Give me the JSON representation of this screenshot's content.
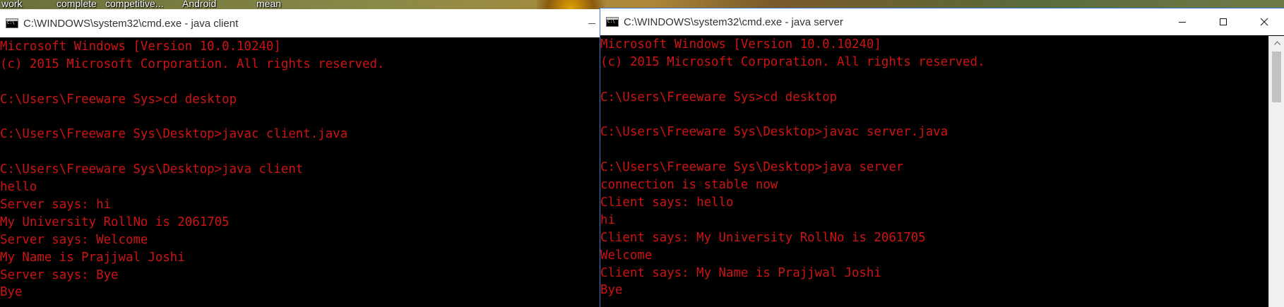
{
  "desktop": {
    "icons": [
      {
        "label": "work"
      },
      {
        "label": "complete"
      },
      {
        "label": "competitive..."
      },
      {
        "label": "Android"
      },
      {
        "label": "mean"
      }
    ]
  },
  "client_window": {
    "title": "C:\\WINDOWS\\system32\\cmd.exe - java  client",
    "lines": [
      "Microsoft Windows [Version 10.0.10240]",
      "(c) 2015 Microsoft Corporation. All rights reserved.",
      "",
      "C:\\Users\\Freeware Sys>cd desktop",
      "",
      "C:\\Users\\Freeware Sys\\Desktop>javac client.java",
      "",
      "C:\\Users\\Freeware Sys\\Desktop>java client",
      "hello",
      "Server says: hi",
      "My University RollNo is 2061705",
      "Server says: Welcome",
      "My Name is Prajjwal Joshi",
      "Server says: Bye",
      "Bye"
    ]
  },
  "server_window": {
    "title": "C:\\WINDOWS\\system32\\cmd.exe - java  server",
    "lines": [
      "Microsoft Windows [Version 10.0.10240]",
      "(c) 2015 Microsoft Corporation. All rights reserved.",
      "",
      "C:\\Users\\Freeware Sys>cd desktop",
      "",
      "C:\\Users\\Freeware Sys\\Desktop>javac server.java",
      "",
      "C:\\Users\\Freeware Sys\\Desktop>java server",
      "connection is stable now",
      "Client says: hello",
      "hi",
      "Client says: My University RollNo is 2061705",
      "Welcome",
      "Client says: My Name is Prajjwal Joshi",
      "Bye"
    ]
  },
  "colors": {
    "console_text": "#cc1414",
    "console_bg": "#000000",
    "titlebar_bg": "#ffffff",
    "active_border": "#3a78c9"
  }
}
